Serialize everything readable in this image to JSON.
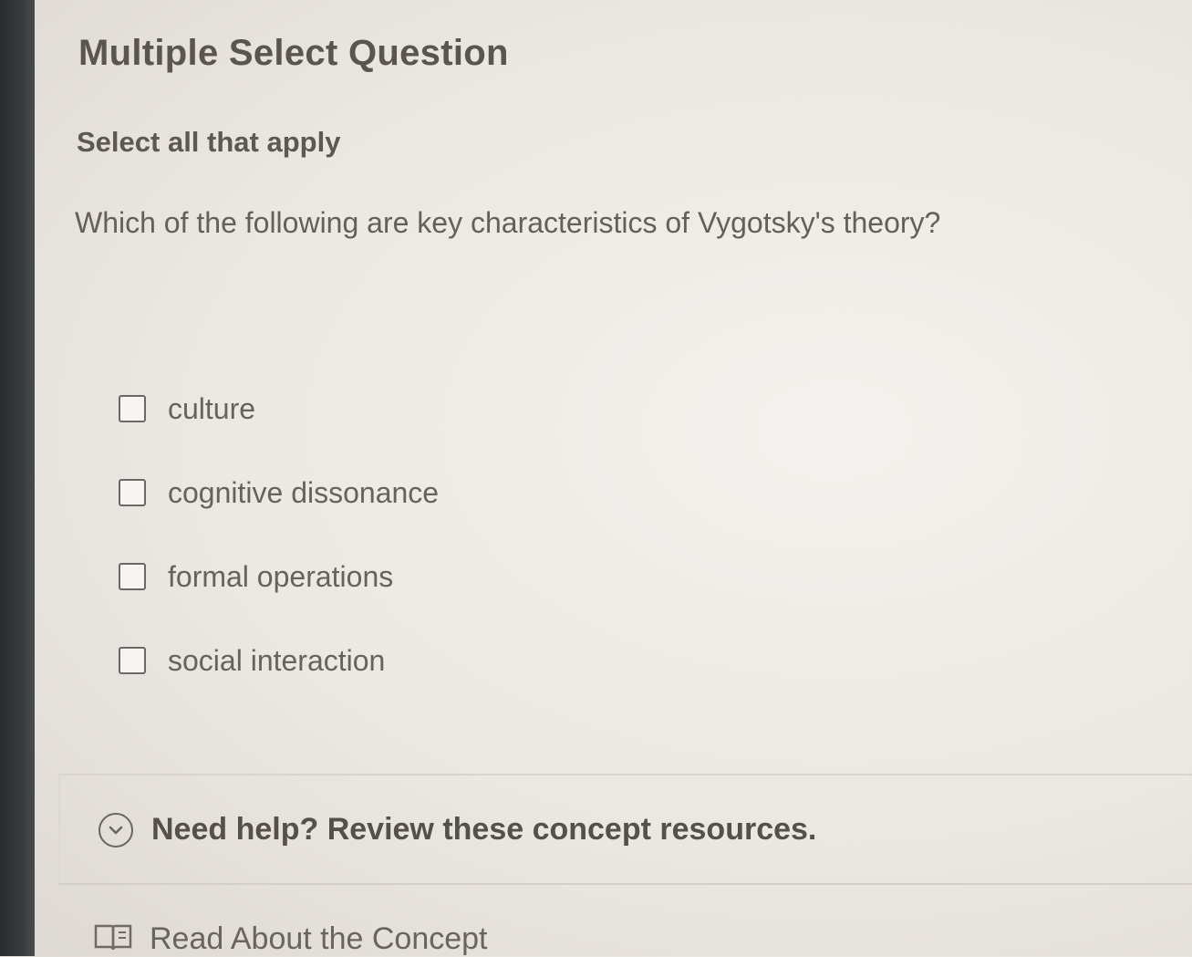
{
  "question": {
    "type_label": "Multiple Select Question",
    "instruction": "Select all that apply",
    "prompt": "Which of the following are key characteristics of Vygotsky's theory?",
    "options": [
      {
        "label": "culture",
        "checked": false
      },
      {
        "label": "cognitive dissonance",
        "checked": false
      },
      {
        "label": "formal operations",
        "checked": false
      },
      {
        "label": "social interaction",
        "checked": false
      }
    ]
  },
  "help": {
    "toggle_label": "Need help? Review these concept resources.",
    "toggle_icon": "chevron-down-circle-icon",
    "resources": [
      {
        "label": "Read About the Concept",
        "icon": "book-icon"
      }
    ]
  }
}
